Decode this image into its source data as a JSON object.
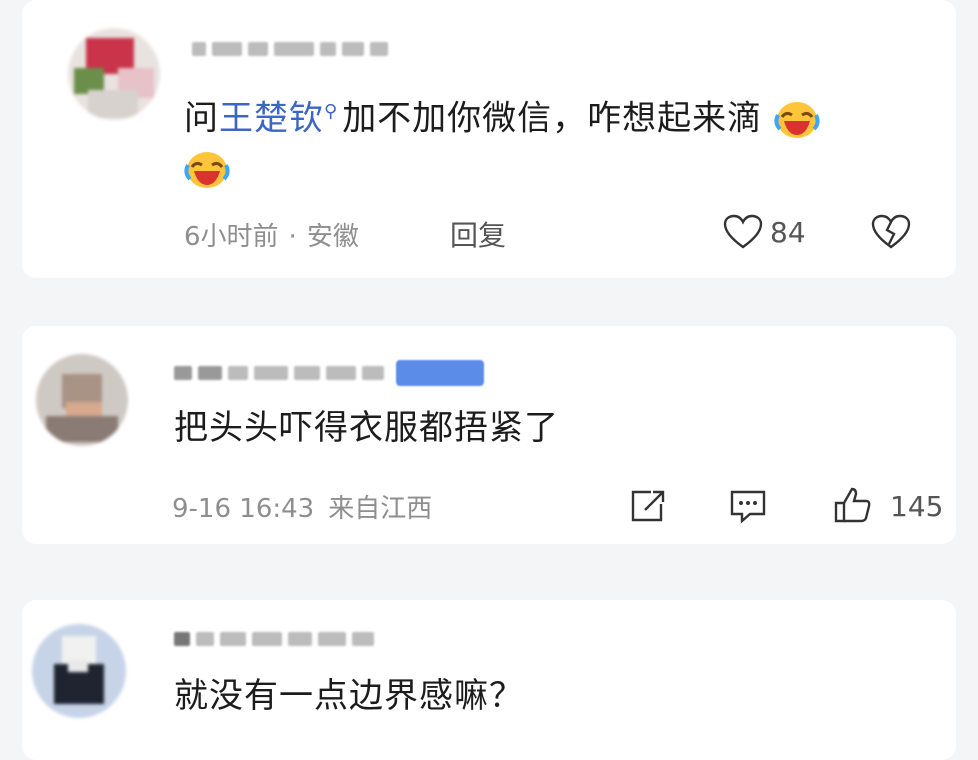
{
  "comments": [
    {
      "text_parts": {
        "prefix": "问",
        "mention": "王楚钦",
        "suffix": "加不加你微信，咋想起来滴"
      },
      "emojis": [
        "laughing-crying-emoji",
        "laughing-crying-emoji"
      ],
      "time": "6小时前",
      "location": "安徽",
      "reply_label": "回复",
      "likes": "84"
    },
    {
      "text": "把头头吓得衣服都捂紧了",
      "time": "9-16 16:43",
      "location": "来自江西",
      "likes": "145"
    },
    {
      "text": "就没有一点边界感嘛？"
    }
  ],
  "colors": {
    "mention": "#3b66c4",
    "badge": "#5b8de8",
    "meta": "#8e8e8e",
    "card": "#ffffff",
    "background": "#f4f5f7"
  },
  "icons": [
    "search-icon",
    "heart-icon",
    "broken-heart-icon",
    "share-icon",
    "comment-icon",
    "thumbs-up-icon"
  ]
}
